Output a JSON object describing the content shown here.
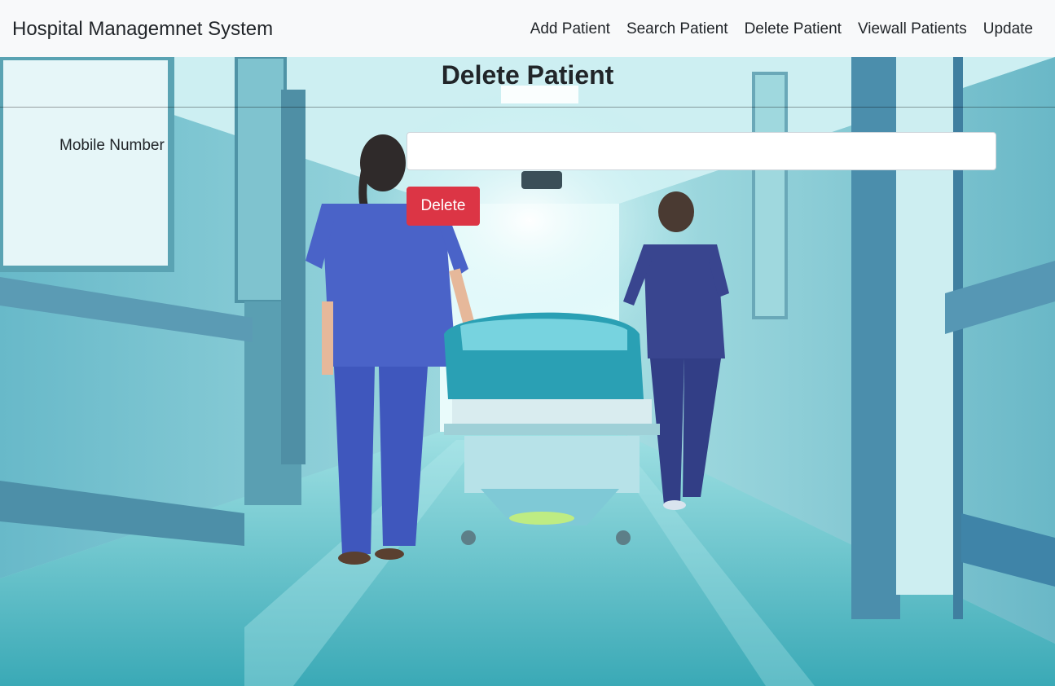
{
  "navbar": {
    "brand": "Hospital Managemnet System",
    "links": [
      {
        "label": "Add Patient"
      },
      {
        "label": "Search Patient"
      },
      {
        "label": "Delete Patient"
      },
      {
        "label": "Viewall Patients"
      },
      {
        "label": "Update"
      }
    ]
  },
  "main": {
    "title": "Delete Patient",
    "form": {
      "mobile_label": "Mobile Number",
      "mobile_value": "",
      "delete_label": "Delete"
    }
  },
  "colors": {
    "navbar_bg": "#f8f9fa",
    "danger": "#dc3545",
    "text": "#212529"
  }
}
